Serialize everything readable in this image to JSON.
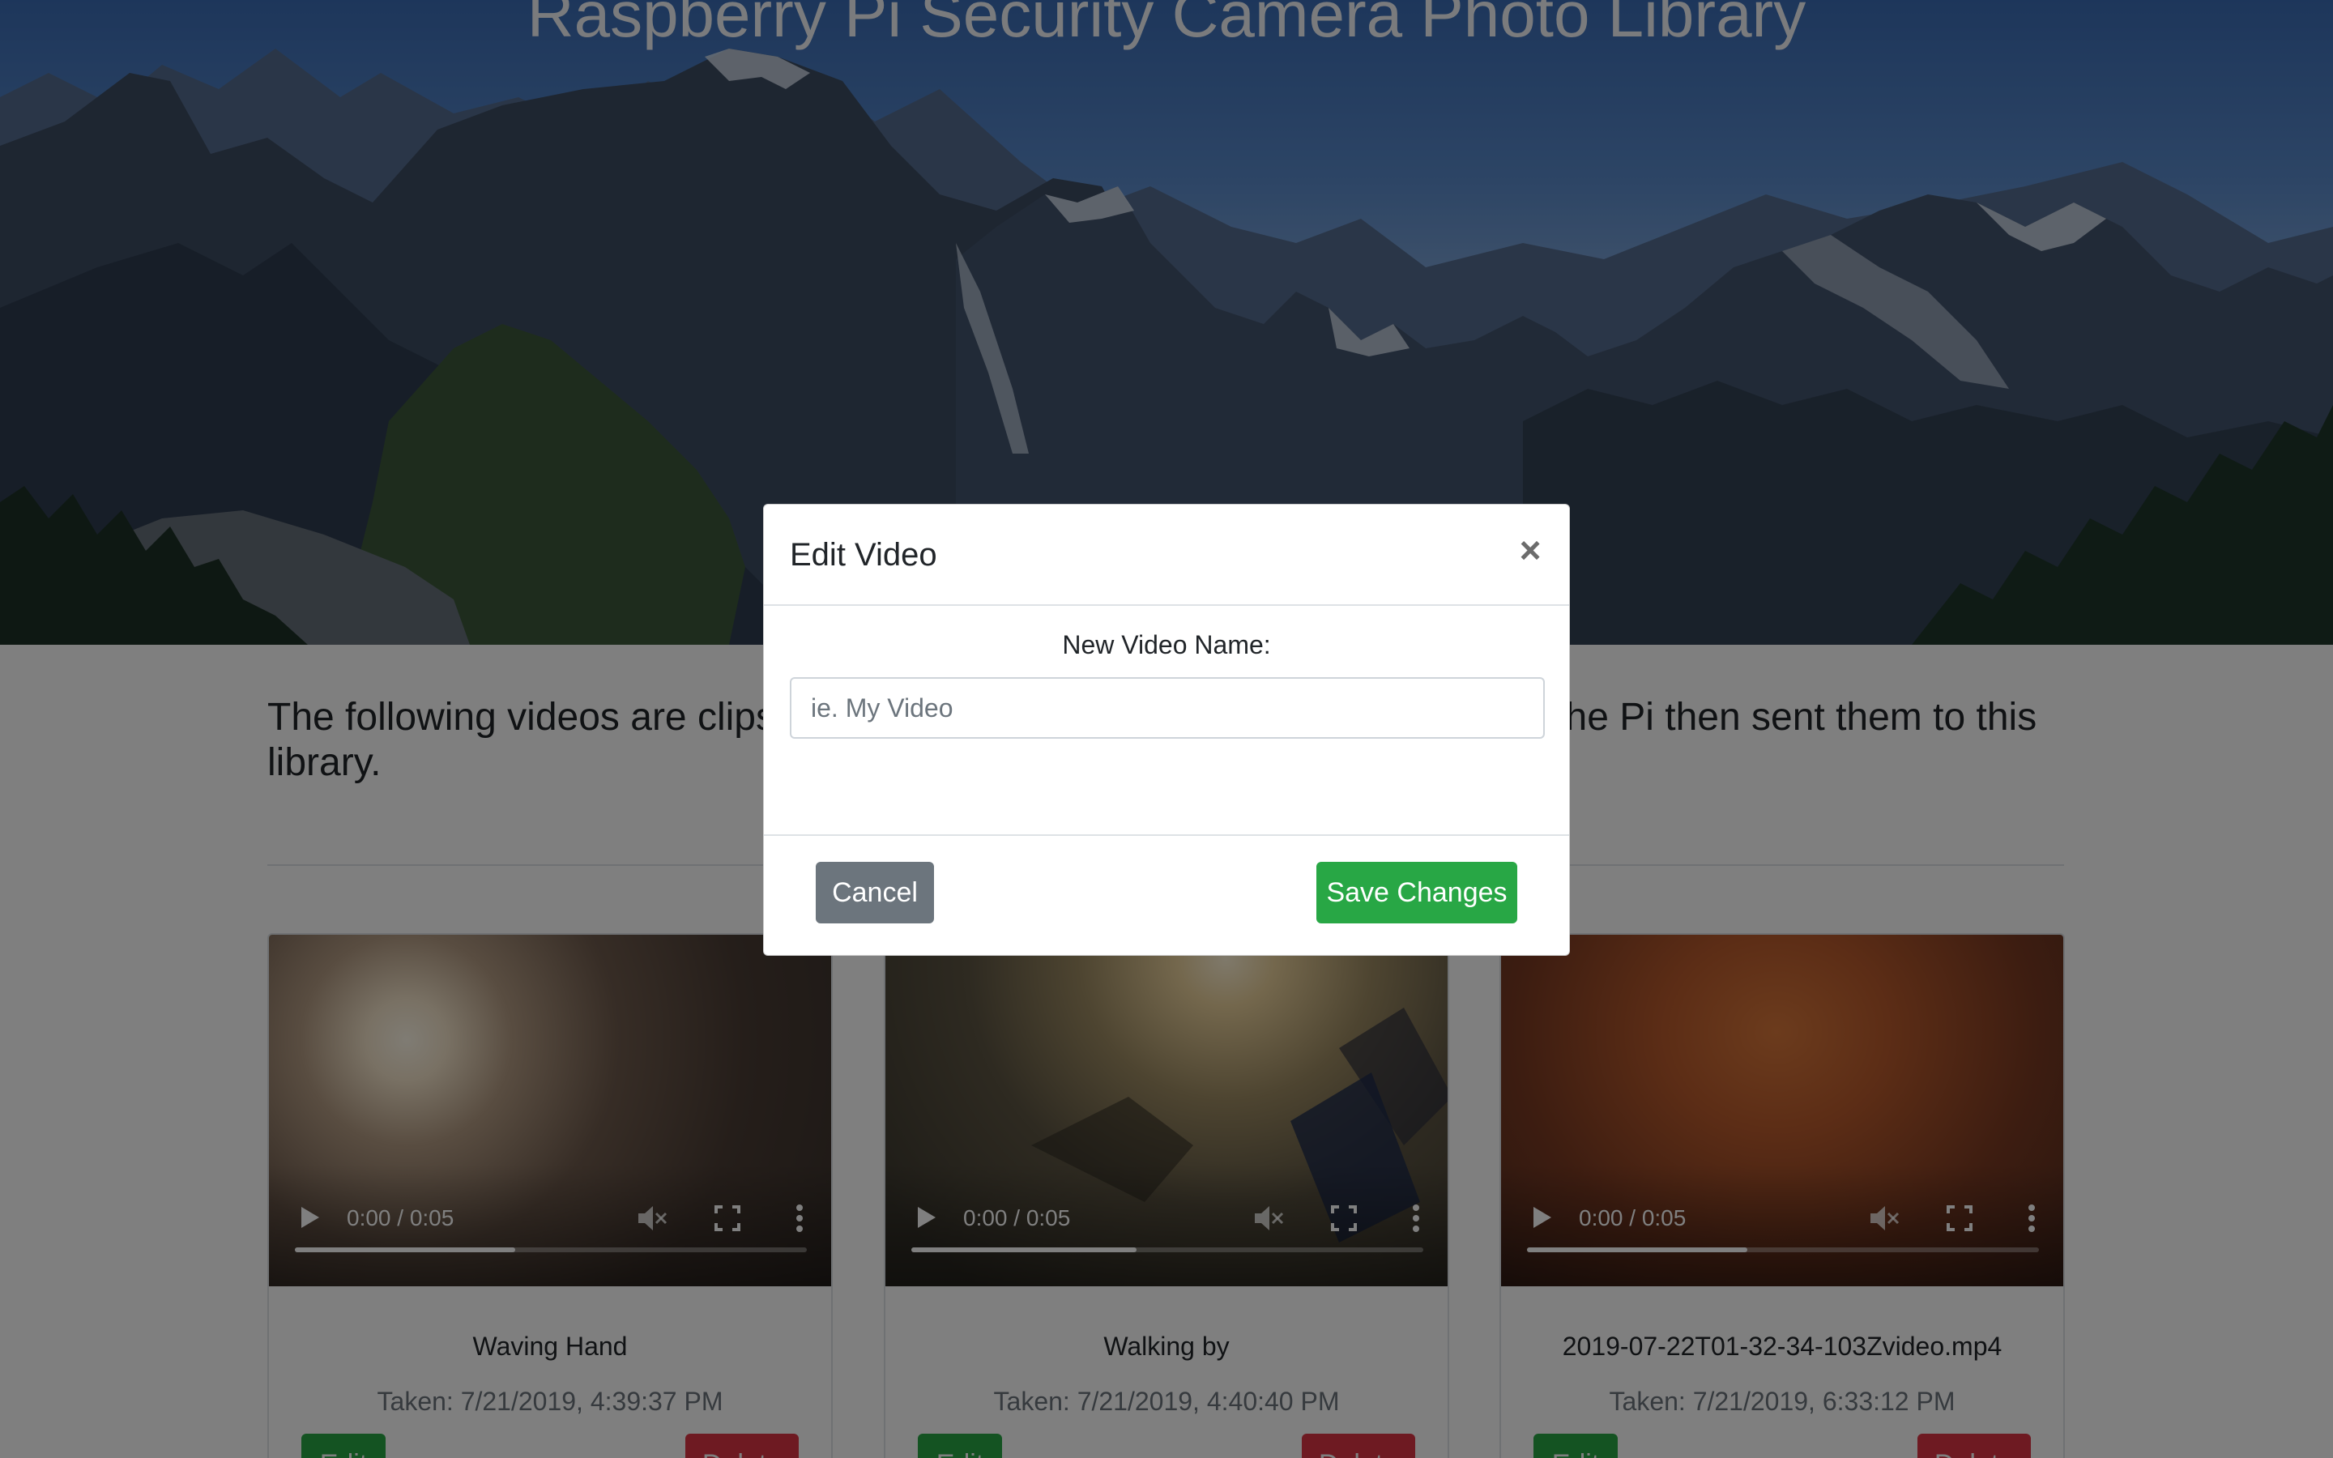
{
  "hero": {
    "title": "Raspberry Pi Security Camera Photo Library"
  },
  "intro": {
    "text": "The following videos are clips that were taken by a Raspberry Pi Camera. The Pi then sent them to this library."
  },
  "videos": [
    {
      "name": "Waving Hand",
      "taken": "Taken: 7/21/2019, 4:39:37 PM",
      "time": "0:00 / 0:05",
      "progress": 0.43,
      "edit_label": "Edit",
      "delete_label": "Delete"
    },
    {
      "name": "Walking by",
      "taken": "Taken: 7/21/2019, 4:40:40 PM",
      "time": "0:00 / 0:05",
      "progress": 0.44,
      "edit_label": "Edit",
      "delete_label": "Delete"
    },
    {
      "name": "2019-07-22T01-32-34-103Zvideo.mp4",
      "taken": "Taken: 7/21/2019, 6:33:12 PM",
      "time": "0:00 / 0:05",
      "progress": 0.43,
      "edit_label": "Edit",
      "delete_label": "Delete"
    }
  ],
  "modal": {
    "title": "Edit Video",
    "close_glyph": "×",
    "field_label": "New Video Name:",
    "input_value": "",
    "input_placeholder": "ie. My Video",
    "cancel_label": "Cancel",
    "save_label": "Save Changes"
  },
  "colors": {
    "success": "#28a745",
    "danger": "#dc3545",
    "secondary": "#6c757d"
  }
}
